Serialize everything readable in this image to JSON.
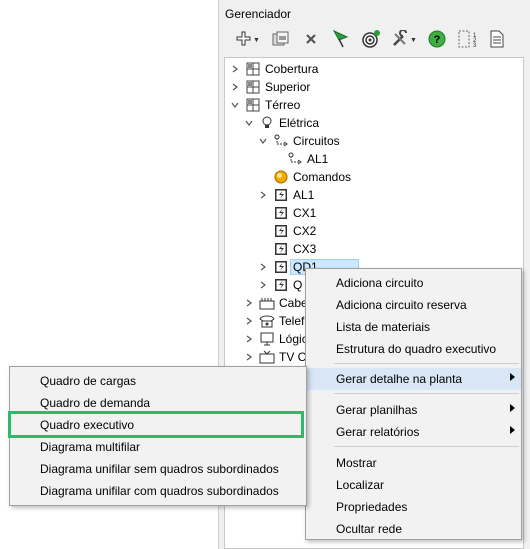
{
  "panel": {
    "title": "Gerenciador"
  },
  "toolbar": {
    "buttons": [
      {
        "name": "add-item-icon"
      },
      {
        "name": "copy-icon"
      },
      {
        "name": "delete-icon"
      },
      {
        "name": "flag-icon"
      },
      {
        "name": "target-icon"
      },
      {
        "name": "tools-icon"
      },
      {
        "name": "help-icon"
      },
      {
        "name": "numbering-icon"
      },
      {
        "name": "document-icon"
      }
    ]
  },
  "tree": {
    "cobertura": "Cobertura",
    "superior": "Superior",
    "terreo": "Térreo",
    "eletrica": "Elétrica",
    "circuitos": "Circuitos",
    "al1_circuit": "AL1",
    "comandos": "Comandos",
    "al1": "AL1",
    "cx1": "CX1",
    "cx2": "CX2",
    "cx3": "CX3",
    "qd1": "QD1",
    "q_partial": "Q",
    "cabe_partial": "Cabe",
    "telef_partial": "Telef",
    "logic_partial": "Lógic",
    "tvc_partial": "TV C"
  },
  "context_menu": {
    "adiciona_circuito": "Adiciona circuito",
    "adiciona_circuito_reserva": "Adiciona circuito reserva",
    "lista_materiais": "Lista de materiais",
    "estrutura_quadro": "Estrutura do quadro executivo",
    "gerar_detalhe": "Gerar detalhe na planta",
    "gerar_planilhas": "Gerar planilhas",
    "gerar_relatorios": "Gerar relatórios",
    "mostrar": "Mostrar",
    "localizar": "Localizar",
    "propriedades": "Propriedades",
    "ocultar_rede": "Ocultar rede"
  },
  "submenu": {
    "quadro_cargas": "Quadro de cargas",
    "quadro_demanda": "Quadro de demanda",
    "quadro_executivo": "Quadro executivo",
    "diagrama_multifilar": "Diagrama multifilar",
    "diagrama_unifilar_sem": "Diagrama unifilar sem quadros subordinados",
    "diagrama_unifilar_com": "Diagrama unifilar com quadros subordinados"
  },
  "colors": {
    "highlight_box": "#2dbb6b",
    "menu_hover": "#d9e6f5",
    "selection": "#cce8ff"
  }
}
